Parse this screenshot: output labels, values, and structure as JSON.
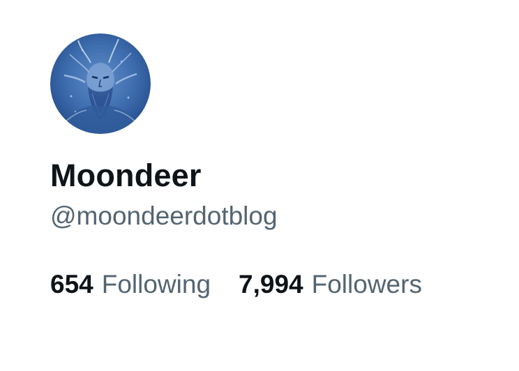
{
  "profile": {
    "avatar_icon": "profile-avatar-bearded-figure",
    "display_name": "Moondeer",
    "handle": "@moondeerdotblog"
  },
  "stats": {
    "following": {
      "count": "654",
      "label": "Following"
    },
    "followers": {
      "count": "7,994",
      "label": "Followers"
    }
  },
  "colors": {
    "text_primary": "#0f1419",
    "text_secondary": "#536471",
    "avatar_blue": "#3b67a8",
    "background": "#ffffff"
  }
}
